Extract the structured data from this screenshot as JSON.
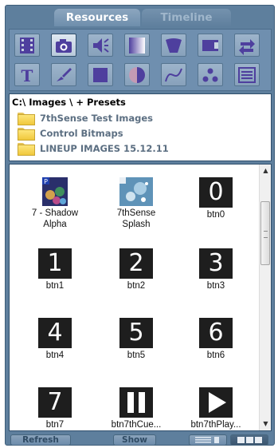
{
  "tabs": [
    {
      "label": "Resources",
      "active": true
    },
    {
      "label": "Timeline",
      "active": false
    }
  ],
  "toolbar": {
    "row1": [
      "film-icon",
      "camera-icon",
      "speaker-icon",
      "gradient-icon",
      "shape-icon",
      "video-icon",
      "swap-arrows-icon"
    ],
    "row2": [
      "text-icon",
      "brush-icon",
      "square-icon",
      "circle-half-icon",
      "curve-icon",
      "dots-icon",
      "list-icon"
    ]
  },
  "tree": {
    "path": "C:\\ Images \\  + Presets",
    "folders": [
      "7thSense Test Images",
      "Control Bitmaps",
      "LINEUP IMAGES 15.12.11"
    ]
  },
  "grid": {
    "items": [
      {
        "label": "7 - Shadow Alpha",
        "line1": "7 - Shadow",
        "line2": "Alpha",
        "kind": "image"
      },
      {
        "label": "7thSense Splash",
        "line1": "7thSense",
        "line2": "Splash",
        "kind": "image"
      },
      {
        "label": "btn0",
        "glyph": "0",
        "kind": "digit"
      },
      {
        "label": "btn1",
        "glyph": "1",
        "kind": "digit"
      },
      {
        "label": "btn2",
        "glyph": "2",
        "kind": "digit"
      },
      {
        "label": "btn3",
        "glyph": "3",
        "kind": "digit"
      },
      {
        "label": "btn4",
        "glyph": "4",
        "kind": "digit"
      },
      {
        "label": "btn5",
        "glyph": "5",
        "kind": "digit"
      },
      {
        "label": "btn6",
        "glyph": "6",
        "kind": "digit"
      },
      {
        "label": "btn7",
        "glyph": "7",
        "kind": "digit"
      },
      {
        "label": "btn7thCue...",
        "kind": "pause"
      },
      {
        "label": "btn7thPlay...",
        "kind": "play"
      }
    ]
  },
  "bottom": {
    "refresh_label": "Refresh",
    "show_label": "Show"
  },
  "colors": {
    "panel": "#5e7f9d",
    "tab_active_text": "#ffffff",
    "tab_inactive_text": "#9fb6cb",
    "toolbar_icon": "#4e3f9e"
  }
}
